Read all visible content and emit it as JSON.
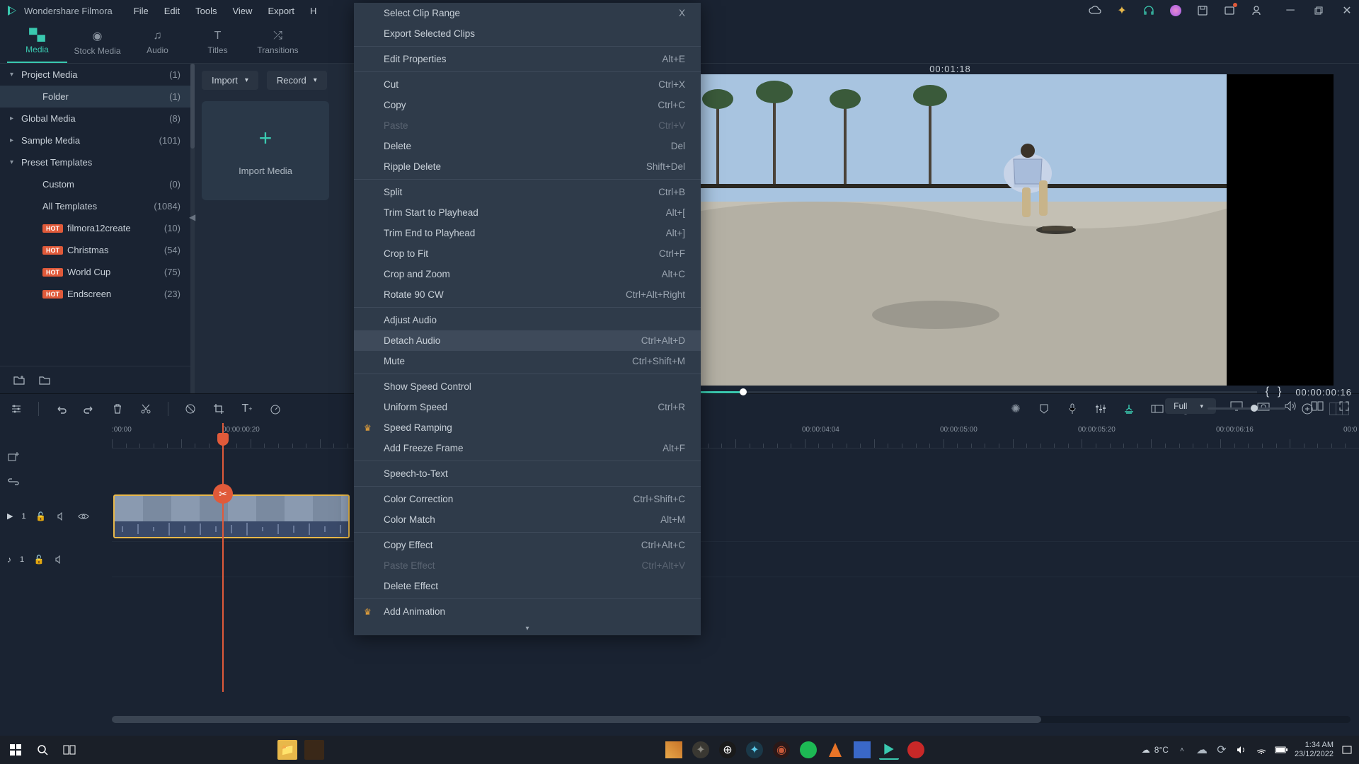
{
  "app": {
    "name": "Wondershare Filmora"
  },
  "menubar": [
    "File",
    "Edit",
    "Tools",
    "View",
    "Export",
    "H"
  ],
  "tabs": [
    {
      "label": "Media",
      "active": true
    },
    {
      "label": "Stock Media"
    },
    {
      "label": "Audio"
    },
    {
      "label": "Titles"
    },
    {
      "label": "Transitions"
    }
  ],
  "sidebar": {
    "items": [
      {
        "label": "Project Media",
        "count": "(1)",
        "arrow": "▾"
      },
      {
        "label": "Folder",
        "count": "(1)",
        "indent": true,
        "selected": true
      },
      {
        "label": "Global Media",
        "count": "(8)",
        "arrow": "▸"
      },
      {
        "label": "Sample Media",
        "count": "(101)",
        "arrow": "▸"
      },
      {
        "label": "Preset Templates",
        "count": "",
        "arrow": "▾"
      },
      {
        "label": "Custom",
        "count": "(0)",
        "indent": true
      },
      {
        "label": "All Templates",
        "count": "(1084)",
        "indent": true
      },
      {
        "label": "filmora12create",
        "count": "(10)",
        "indent": true,
        "hot": true
      },
      {
        "label": "Christmas",
        "count": "(54)",
        "indent": true,
        "hot": true
      },
      {
        "label": "World Cup",
        "count": "(75)",
        "indent": true,
        "hot": true
      },
      {
        "label": "Endscreen",
        "count": "(23)",
        "indent": true,
        "hot": true
      }
    ]
  },
  "media_panel": {
    "import_btn": "Import",
    "record_btn": "Record",
    "import_label": "Import Media"
  },
  "preview": {
    "timecode_top": "00:01:18",
    "timecode_right": "00:00:00:16",
    "quality": "Full",
    "bracket_open": "{",
    "bracket_close": "}"
  },
  "context_menu": [
    {
      "label": "Select Clip Range",
      "shortcut": "X"
    },
    {
      "label": "Export Selected Clips"
    },
    {
      "sep": true
    },
    {
      "label": "Edit Properties",
      "shortcut": "Alt+E"
    },
    {
      "sep": true
    },
    {
      "label": "Cut",
      "shortcut": "Ctrl+X"
    },
    {
      "label": "Copy",
      "shortcut": "Ctrl+C"
    },
    {
      "label": "Paste",
      "shortcut": "Ctrl+V",
      "disabled": true
    },
    {
      "label": "Delete",
      "shortcut": "Del"
    },
    {
      "label": "Ripple Delete",
      "shortcut": "Shift+Del"
    },
    {
      "sep": true
    },
    {
      "label": "Split",
      "shortcut": "Ctrl+B"
    },
    {
      "label": "Trim Start to Playhead",
      "shortcut": "Alt+["
    },
    {
      "label": "Trim End to Playhead",
      "shortcut": "Alt+]"
    },
    {
      "label": "Crop to Fit",
      "shortcut": "Ctrl+F"
    },
    {
      "label": "Crop and Zoom",
      "shortcut": "Alt+C"
    },
    {
      "label": "Rotate 90 CW",
      "shortcut": "Ctrl+Alt+Right"
    },
    {
      "sep": true
    },
    {
      "label": "Adjust Audio"
    },
    {
      "label": "Detach Audio",
      "shortcut": "Ctrl+Alt+D",
      "highlight": true
    },
    {
      "label": "Mute",
      "shortcut": "Ctrl+Shift+M"
    },
    {
      "sep": true
    },
    {
      "label": "Show Speed Control"
    },
    {
      "label": "Uniform Speed",
      "shortcut": "Ctrl+R"
    },
    {
      "label": "Speed Ramping",
      "crown": true
    },
    {
      "label": "Add Freeze Frame",
      "shortcut": "Alt+F"
    },
    {
      "sep": true
    },
    {
      "label": "Speech-to-Text"
    },
    {
      "sep": true
    },
    {
      "label": "Color Correction",
      "shortcut": "Ctrl+Shift+C"
    },
    {
      "label": "Color Match",
      "shortcut": "Alt+M"
    },
    {
      "sep": true
    },
    {
      "label": "Copy Effect",
      "shortcut": "Ctrl+Alt+C"
    },
    {
      "label": "Paste Effect",
      "shortcut": "Ctrl+Alt+V",
      "disabled": true
    },
    {
      "label": "Delete Effect"
    },
    {
      "sep": true
    },
    {
      "label": "Add Animation",
      "crown": true
    }
  ],
  "ruler": {
    "labels": [
      {
        "text": ":00:00",
        "pos": 0
      },
      {
        "text": "00:00:00:20",
        "pos": 156
      },
      {
        "text": "00:00:04:04",
        "pos": 975
      },
      {
        "text": "00:00:05:00",
        "pos": 1170
      },
      {
        "text": "00:00:05:20",
        "pos": 1365
      },
      {
        "text": "00:00:06:16",
        "pos": 1560
      },
      {
        "text": "00:0",
        "pos": 1740
      }
    ]
  },
  "tracks": {
    "video": {
      "icon": "▶",
      "num": "1"
    },
    "audio": {
      "icon": "♪",
      "num": "1"
    }
  },
  "taskbar": {
    "weather_temp": "8°C",
    "time": "1:34 AM",
    "date": "23/12/2022"
  }
}
